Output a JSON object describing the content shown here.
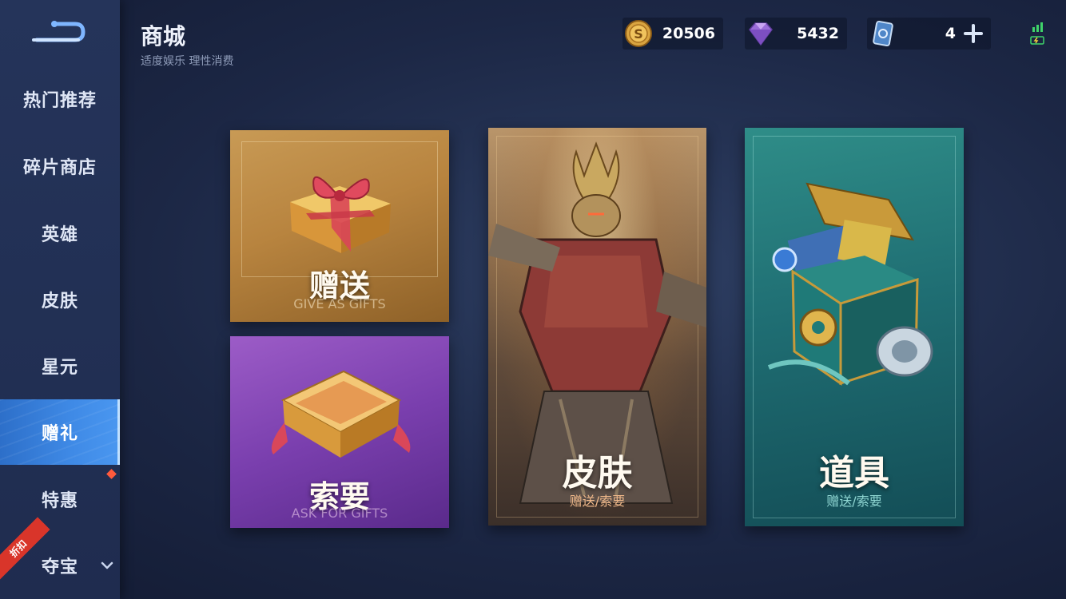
{
  "header": {
    "title": "商城",
    "subtitle": "适度娱乐 理性消费"
  },
  "currencies": [
    {
      "icon": "gold-coin-icon",
      "value": "20506"
    },
    {
      "icon": "diamond-icon",
      "value": "5432"
    },
    {
      "icon": "voucher-icon",
      "value": "4"
    }
  ],
  "sidebar": {
    "items": [
      {
        "label": "热门推荐"
      },
      {
        "label": "碎片商店"
      },
      {
        "label": "英雄"
      },
      {
        "label": "皮肤"
      },
      {
        "label": "星元"
      },
      {
        "label": "赠礼",
        "active": true
      },
      {
        "label": "特惠"
      },
      {
        "label": "夺宝"
      }
    ],
    "discount_tag": "折扣"
  },
  "cards": {
    "gift": {
      "title": "赠送",
      "subtitle": "GIVE AS GIFTS"
    },
    "ask": {
      "title": "索要",
      "subtitle": "ASK FOR GIFTS"
    },
    "skin": {
      "title": "皮肤",
      "subtitle": "赠送/索要"
    },
    "props": {
      "title": "道具",
      "subtitle": "赠送/索要"
    }
  },
  "colors": {
    "active_tab": "#3f8ae6",
    "gift_card": "#b8843f",
    "ask_card": "#7a3fae",
    "props_card": "#1f6e73"
  }
}
